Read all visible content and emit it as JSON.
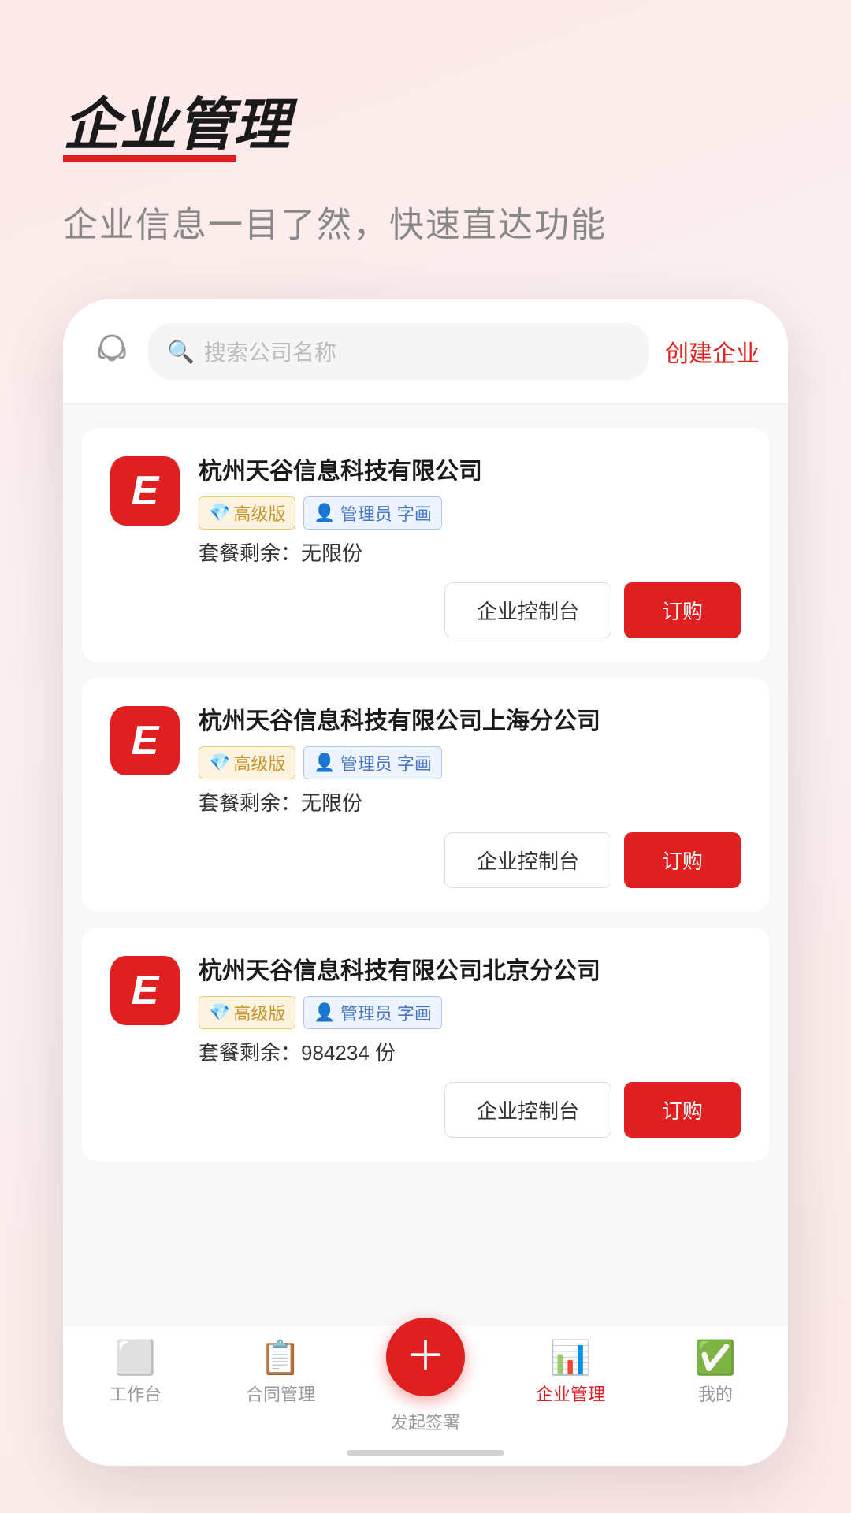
{
  "header": {
    "title": "企业管理",
    "subtitle": "企业信息一目了然，快速直达功能"
  },
  "search": {
    "placeholder": "搜索公司名称",
    "create_label": "创建企业"
  },
  "companies": [
    {
      "id": 1,
      "name": "杭州天谷信息科技有限公司",
      "plan": "高级版",
      "role": "管理员",
      "user": "字画",
      "quota_label": "套餐剩余：",
      "quota_value": "无限份",
      "btn_control": "企业控制台",
      "btn_order": "订购"
    },
    {
      "id": 2,
      "name": "杭州天谷信息科技有限公司上海分公司",
      "plan": "高级版",
      "role": "管理员",
      "user": "字画",
      "quota_label": "套餐剩余：",
      "quota_value": "无限份",
      "btn_control": "企业控制台",
      "btn_order": "订购"
    },
    {
      "id": 3,
      "name": "杭州天谷信息科技有限公司北京分公司",
      "plan": "高级版",
      "role": "管理员",
      "user": "字画",
      "quota_label": "套餐剩余：",
      "quota_value": "984234 份",
      "btn_control": "企业控制台",
      "btn_order": "订购"
    }
  ],
  "nav": {
    "items": [
      {
        "id": "workbench",
        "label": "工作台",
        "active": false
      },
      {
        "id": "contract",
        "label": "合同管理",
        "active": false
      },
      {
        "id": "sign",
        "label": "发起签署",
        "active": false,
        "fab": true
      },
      {
        "id": "enterprise",
        "label": "企业管理",
        "active": true
      },
      {
        "id": "mine",
        "label": "我的",
        "active": false
      }
    ]
  }
}
